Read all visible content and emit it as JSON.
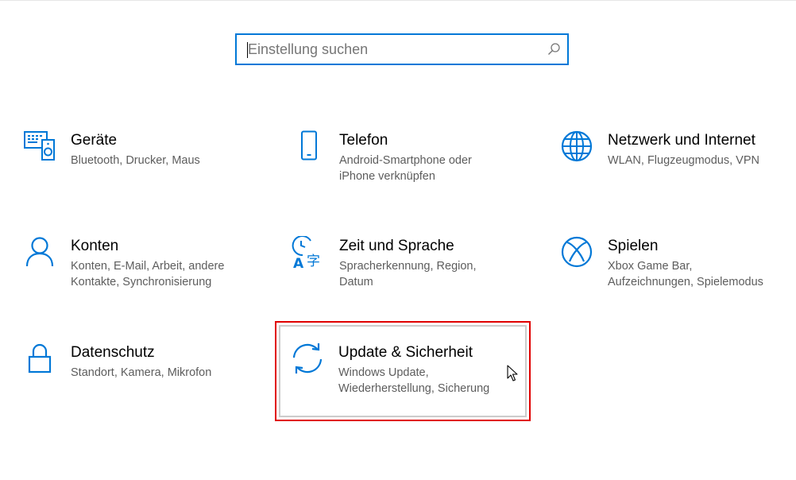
{
  "search": {
    "placeholder": "Einstellung suchen",
    "icon": "search-icon"
  },
  "accent_color": "#0078d7",
  "highlight_color": "#e00000",
  "tiles": [
    {
      "icon": "devices-icon",
      "title": "Geräte",
      "desc": "Bluetooth, Drucker, Maus"
    },
    {
      "icon": "phone-icon",
      "title": "Telefon",
      "desc": "Android-Smartphone oder\niPhone verknüpfen"
    },
    {
      "icon": "globe-icon",
      "title": "Netzwerk und Internet",
      "desc": "WLAN, Flugzeugmodus, VPN"
    },
    {
      "icon": "person-icon",
      "title": "Konten",
      "desc": "Konten, E-Mail, Arbeit, andere\nKontakte, Synchronisierung"
    },
    {
      "icon": "time-language-icon",
      "title": "Zeit und Sprache",
      "desc": "Spracherkennung, Region,\nDatum"
    },
    {
      "icon": "xbox-icon",
      "title": "Spielen",
      "desc": "Xbox Game Bar,\nAufzeichnungen, Spielemodus"
    },
    {
      "icon": "lock-icon",
      "title": "Datenschutz",
      "desc": "Standort, Kamera, Mikrofon"
    },
    {
      "icon": "sync-icon",
      "title": "Update & Sicherheit",
      "desc": "Windows Update,\nWiederherstellung, Sicherung"
    }
  ]
}
